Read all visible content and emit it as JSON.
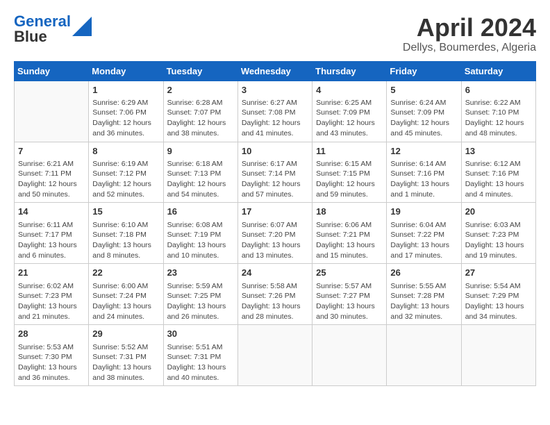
{
  "logo": {
    "line1": "General",
    "line2": "Blue"
  },
  "title": "April 2024",
  "subtitle": "Dellys, Boumerdes, Algeria",
  "days_of_week": [
    "Sunday",
    "Monday",
    "Tuesday",
    "Wednesday",
    "Thursday",
    "Friday",
    "Saturday"
  ],
  "weeks": [
    [
      {
        "day": "",
        "info": ""
      },
      {
        "day": "1",
        "info": "Sunrise: 6:29 AM\nSunset: 7:06 PM\nDaylight: 12 hours\nand 36 minutes."
      },
      {
        "day": "2",
        "info": "Sunrise: 6:28 AM\nSunset: 7:07 PM\nDaylight: 12 hours\nand 38 minutes."
      },
      {
        "day": "3",
        "info": "Sunrise: 6:27 AM\nSunset: 7:08 PM\nDaylight: 12 hours\nand 41 minutes."
      },
      {
        "day": "4",
        "info": "Sunrise: 6:25 AM\nSunset: 7:09 PM\nDaylight: 12 hours\nand 43 minutes."
      },
      {
        "day": "5",
        "info": "Sunrise: 6:24 AM\nSunset: 7:09 PM\nDaylight: 12 hours\nand 45 minutes."
      },
      {
        "day": "6",
        "info": "Sunrise: 6:22 AM\nSunset: 7:10 PM\nDaylight: 12 hours\nand 48 minutes."
      }
    ],
    [
      {
        "day": "7",
        "info": "Sunrise: 6:21 AM\nSunset: 7:11 PM\nDaylight: 12 hours\nand 50 minutes."
      },
      {
        "day": "8",
        "info": "Sunrise: 6:19 AM\nSunset: 7:12 PM\nDaylight: 12 hours\nand 52 minutes."
      },
      {
        "day": "9",
        "info": "Sunrise: 6:18 AM\nSunset: 7:13 PM\nDaylight: 12 hours\nand 54 minutes."
      },
      {
        "day": "10",
        "info": "Sunrise: 6:17 AM\nSunset: 7:14 PM\nDaylight: 12 hours\nand 57 minutes."
      },
      {
        "day": "11",
        "info": "Sunrise: 6:15 AM\nSunset: 7:15 PM\nDaylight: 12 hours\nand 59 minutes."
      },
      {
        "day": "12",
        "info": "Sunrise: 6:14 AM\nSunset: 7:16 PM\nDaylight: 13 hours\nand 1 minute."
      },
      {
        "day": "13",
        "info": "Sunrise: 6:12 AM\nSunset: 7:16 PM\nDaylight: 13 hours\nand 4 minutes."
      }
    ],
    [
      {
        "day": "14",
        "info": "Sunrise: 6:11 AM\nSunset: 7:17 PM\nDaylight: 13 hours\nand 6 minutes."
      },
      {
        "day": "15",
        "info": "Sunrise: 6:10 AM\nSunset: 7:18 PM\nDaylight: 13 hours\nand 8 minutes."
      },
      {
        "day": "16",
        "info": "Sunrise: 6:08 AM\nSunset: 7:19 PM\nDaylight: 13 hours\nand 10 minutes."
      },
      {
        "day": "17",
        "info": "Sunrise: 6:07 AM\nSunset: 7:20 PM\nDaylight: 13 hours\nand 13 minutes."
      },
      {
        "day": "18",
        "info": "Sunrise: 6:06 AM\nSunset: 7:21 PM\nDaylight: 13 hours\nand 15 minutes."
      },
      {
        "day": "19",
        "info": "Sunrise: 6:04 AM\nSunset: 7:22 PM\nDaylight: 13 hours\nand 17 minutes."
      },
      {
        "day": "20",
        "info": "Sunrise: 6:03 AM\nSunset: 7:23 PM\nDaylight: 13 hours\nand 19 minutes."
      }
    ],
    [
      {
        "day": "21",
        "info": "Sunrise: 6:02 AM\nSunset: 7:23 PM\nDaylight: 13 hours\nand 21 minutes."
      },
      {
        "day": "22",
        "info": "Sunrise: 6:00 AM\nSunset: 7:24 PM\nDaylight: 13 hours\nand 24 minutes."
      },
      {
        "day": "23",
        "info": "Sunrise: 5:59 AM\nSunset: 7:25 PM\nDaylight: 13 hours\nand 26 minutes."
      },
      {
        "day": "24",
        "info": "Sunrise: 5:58 AM\nSunset: 7:26 PM\nDaylight: 13 hours\nand 28 minutes."
      },
      {
        "day": "25",
        "info": "Sunrise: 5:57 AM\nSunset: 7:27 PM\nDaylight: 13 hours\nand 30 minutes."
      },
      {
        "day": "26",
        "info": "Sunrise: 5:55 AM\nSunset: 7:28 PM\nDaylight: 13 hours\nand 32 minutes."
      },
      {
        "day": "27",
        "info": "Sunrise: 5:54 AM\nSunset: 7:29 PM\nDaylight: 13 hours\nand 34 minutes."
      }
    ],
    [
      {
        "day": "28",
        "info": "Sunrise: 5:53 AM\nSunset: 7:30 PM\nDaylight: 13 hours\nand 36 minutes."
      },
      {
        "day": "29",
        "info": "Sunrise: 5:52 AM\nSunset: 7:31 PM\nDaylight: 13 hours\nand 38 minutes."
      },
      {
        "day": "30",
        "info": "Sunrise: 5:51 AM\nSunset: 7:31 PM\nDaylight: 13 hours\nand 40 minutes."
      },
      {
        "day": "",
        "info": ""
      },
      {
        "day": "",
        "info": ""
      },
      {
        "day": "",
        "info": ""
      },
      {
        "day": "",
        "info": ""
      }
    ]
  ]
}
